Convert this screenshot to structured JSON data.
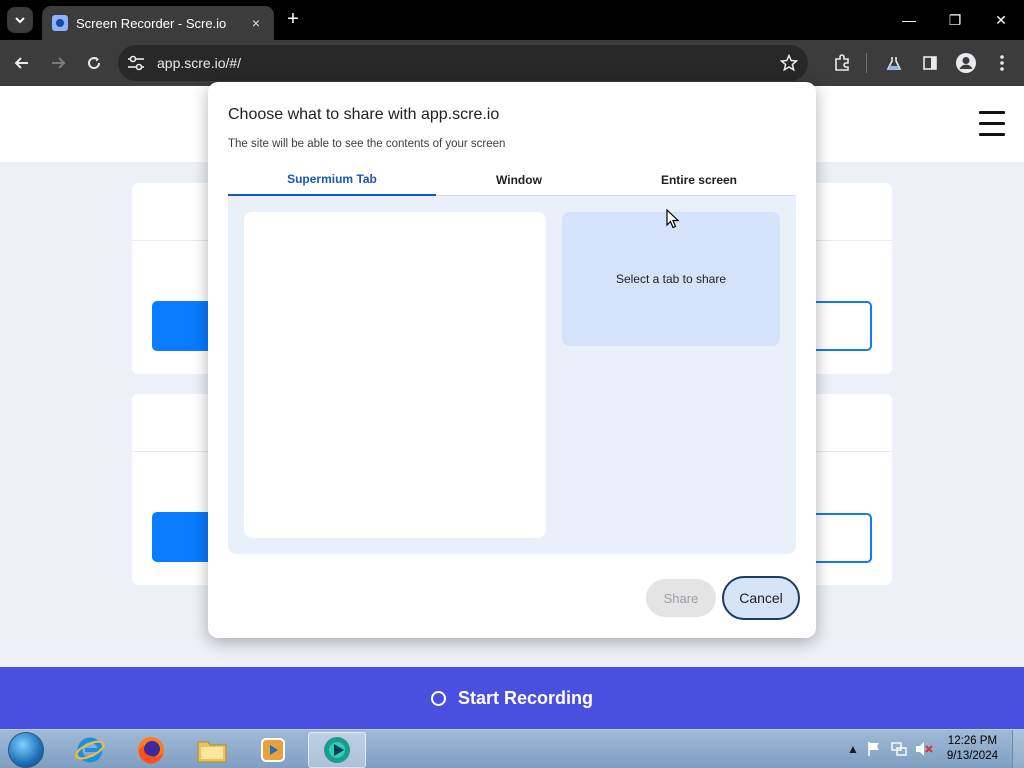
{
  "browser": {
    "tab_title": "Screen Recorder - Scre.io",
    "tab_close_icon": "×",
    "new_tab_icon": "+",
    "url": "app.scre.io/#/",
    "window_controls": {
      "minimize": "—",
      "restore": "❐",
      "close": "✕"
    }
  },
  "dialog": {
    "title": "Choose what to share with app.scre.io",
    "subtitle": "The site will be able to see the contents of your screen",
    "tabs": [
      {
        "label": "Supermium Tab",
        "active": true
      },
      {
        "label": "Window",
        "active": false
      },
      {
        "label": "Entire screen",
        "active": false
      }
    ],
    "preview_text": "Select a tab to share",
    "share_label": "Share",
    "cancel_label": "Cancel"
  },
  "page": {
    "start_recording_label": "Start Recording"
  },
  "taskbar": {
    "time": "12:26 PM",
    "date": "9/13/2024"
  },
  "colors": {
    "accent_blue": "#0a7cff",
    "start_bar": "#4950e0",
    "dialog_active_tab": "#1a56b8"
  }
}
